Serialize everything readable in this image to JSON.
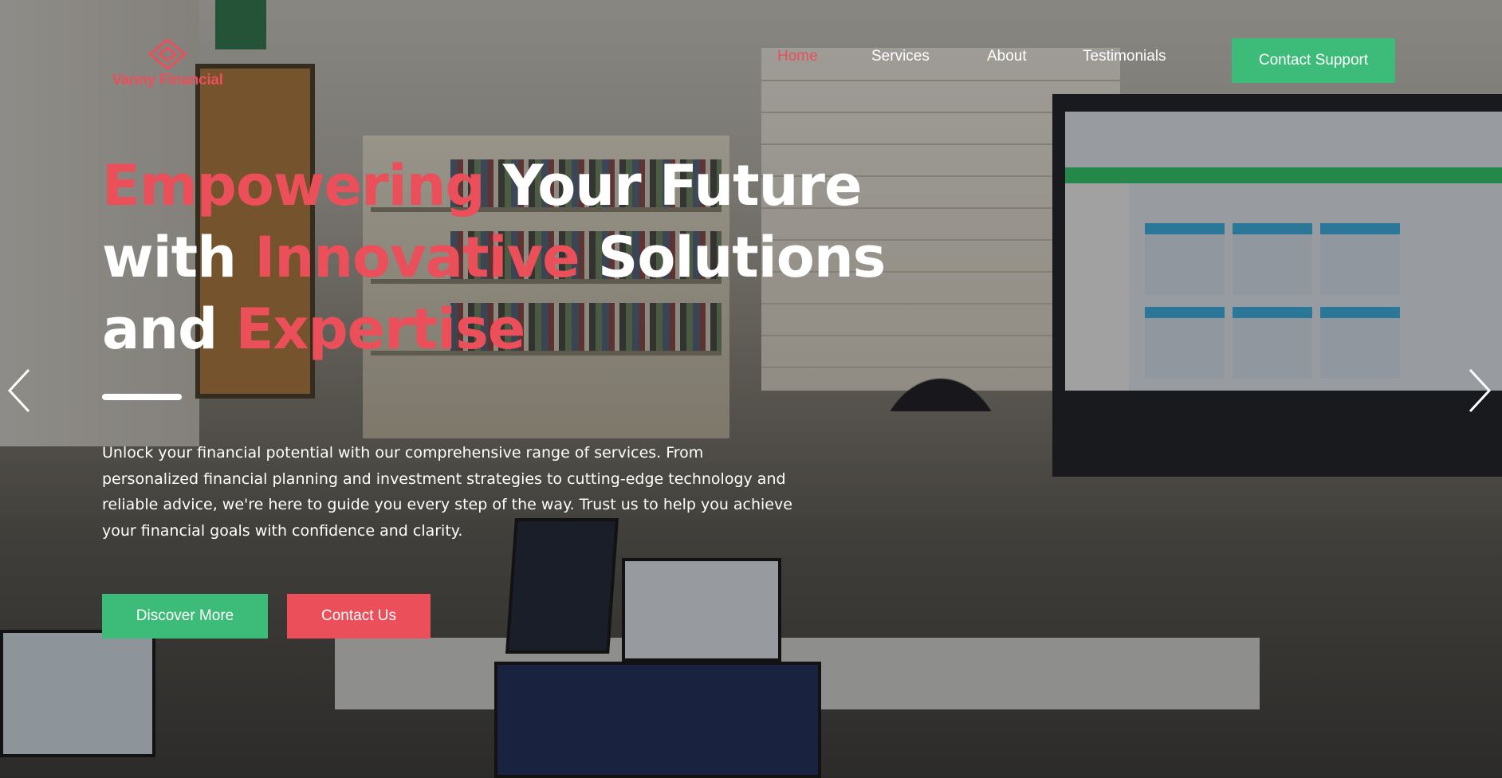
{
  "brand": {
    "name": "Vanny Financial",
    "accent_color": "#ea4f5a",
    "green_color": "#3dbb78"
  },
  "nav": {
    "items": [
      {
        "label": "Home",
        "active": true
      },
      {
        "label": "Services",
        "active": false
      },
      {
        "label": "About",
        "active": false
      },
      {
        "label": "Testimonials",
        "active": false
      }
    ],
    "cta_label": "Contact Support"
  },
  "hero": {
    "headline": {
      "line1_accent": "Empowering",
      "line1_rest": " Your Future",
      "line2_start": "with ",
      "line2_accent": "Innovative",
      "line2_rest": " Solutions",
      "line3_start": "and ",
      "line3_accent": "Expertise"
    },
    "description": "Unlock your financial potential with our comprehensive range of services. From personalized financial planning and investment strategies to cutting-edge technology and reliable advice, we're here to guide you every step of the way. Trust us to help you achieve your financial goals with confidence and clarity.",
    "primary_button": "Discover More",
    "secondary_button": "Contact Us"
  },
  "carousel": {
    "prev_icon": "chevron-left-icon",
    "next_icon": "chevron-right-icon"
  }
}
